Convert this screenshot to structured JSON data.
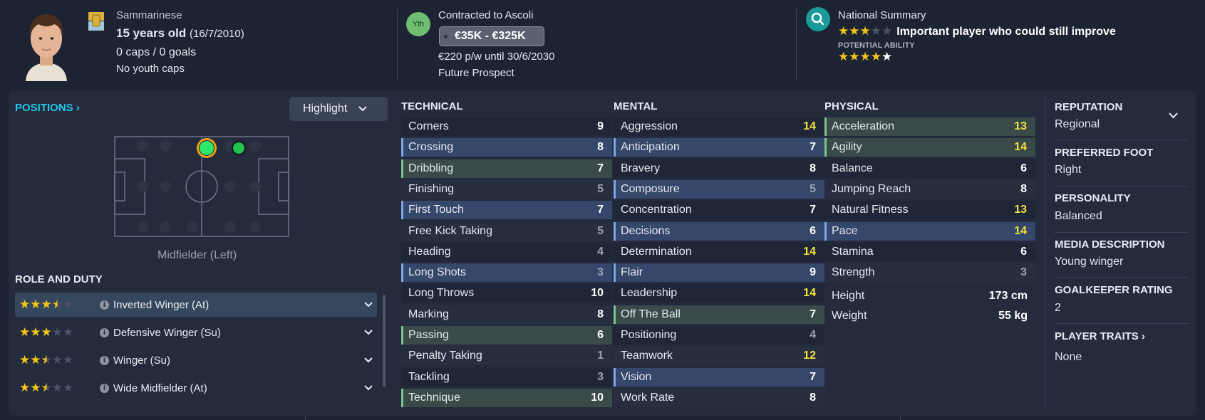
{
  "header": {
    "nationality": "Sammarinese",
    "age": "15 years old",
    "dob": "(16/7/2010)",
    "caps": "0 caps / 0 goals",
    "youth_caps": "No youth caps",
    "contract_badge": "Yth",
    "contract_title": "Contracted to Ascoli",
    "value_range": "€35K - €325K",
    "wage": "€220 p/w until 30/6/2030",
    "prospect": "Future Prospect",
    "summary_title": "National Summary",
    "summary_text": "Important player who could still improve",
    "current_stars": 3,
    "potential_label": "POTENTIAL ABILITY",
    "potential_stars": 4.5
  },
  "positions": {
    "title": "POSITIONS",
    "highlight": "Highlight",
    "position_label": "Midfielder (Left)"
  },
  "roles": {
    "title": "ROLE AND DUTY",
    "items": [
      {
        "name": "Inverted Winger (At)",
        "stars": 3.5
      },
      {
        "name": "Defensive Winger (Su)",
        "stars": 3
      },
      {
        "name": "Winger (Su)",
        "stars": 2.5
      },
      {
        "name": "Wide Midfielder (At)",
        "stars": 2.5
      }
    ]
  },
  "technical": {
    "title": "TECHNICAL",
    "attrs": [
      {
        "name": "Corners",
        "value": "9"
      },
      {
        "name": "Crossing",
        "value": "8"
      },
      {
        "name": "Dribbling",
        "value": "7"
      },
      {
        "name": "Finishing",
        "value": "5"
      },
      {
        "name": "First Touch",
        "value": "7"
      },
      {
        "name": "Free Kick Taking",
        "value": "5"
      },
      {
        "name": "Heading",
        "value": "4"
      },
      {
        "name": "Long Shots",
        "value": "3"
      },
      {
        "name": "Long Throws",
        "value": "10"
      },
      {
        "name": "Marking",
        "value": "8"
      },
      {
        "name": "Passing",
        "value": "6"
      },
      {
        "name": "Penalty Taking",
        "value": "1"
      },
      {
        "name": "Tackling",
        "value": "3"
      },
      {
        "name": "Technique",
        "value": "10"
      }
    ]
  },
  "mental": {
    "title": "MENTAL",
    "attrs": [
      {
        "name": "Aggression",
        "value": "14"
      },
      {
        "name": "Anticipation",
        "value": "7"
      },
      {
        "name": "Bravery",
        "value": "8"
      },
      {
        "name": "Composure",
        "value": "5"
      },
      {
        "name": "Concentration",
        "value": "7"
      },
      {
        "name": "Decisions",
        "value": "6"
      },
      {
        "name": "Determination",
        "value": "14"
      },
      {
        "name": "Flair",
        "value": "9"
      },
      {
        "name": "Leadership",
        "value": "14"
      },
      {
        "name": "Off The Ball",
        "value": "7"
      },
      {
        "name": "Positioning",
        "value": "4"
      },
      {
        "name": "Teamwork",
        "value": "12"
      },
      {
        "name": "Vision",
        "value": "7"
      },
      {
        "name": "Work Rate",
        "value": "8"
      }
    ]
  },
  "physical": {
    "title": "PHYSICAL",
    "attrs": [
      {
        "name": "Acceleration",
        "value": "13"
      },
      {
        "name": "Agility",
        "value": "14"
      },
      {
        "name": "Balance",
        "value": "6"
      },
      {
        "name": "Jumping Reach",
        "value": "8"
      },
      {
        "name": "Natural Fitness",
        "value": "13"
      },
      {
        "name": "Pace",
        "value": "14"
      },
      {
        "name": "Stamina",
        "value": "6"
      },
      {
        "name": "Strength",
        "value": "3"
      }
    ],
    "height_label": "Height",
    "height_value": "173 cm",
    "weight_label": "Weight",
    "weight_value": "55 kg"
  },
  "info": {
    "reputation_label": "REPUTATION",
    "reputation": "Regional",
    "foot_label": "PREFERRED FOOT",
    "foot": "Right",
    "personality_label": "PERSONALITY",
    "personality": "Balanced",
    "media_label": "MEDIA DESCRIPTION",
    "media": "Young winger",
    "gk_label": "GOALKEEPER RATING",
    "gk": "2",
    "traits_label": "PLAYER TRAITS",
    "traits": "None"
  },
  "colors": {
    "accent_cyan": "#22c8e8",
    "yellow_value": "#f2e23a",
    "star": "#f5c518",
    "pos_green": "#2ee86a"
  }
}
